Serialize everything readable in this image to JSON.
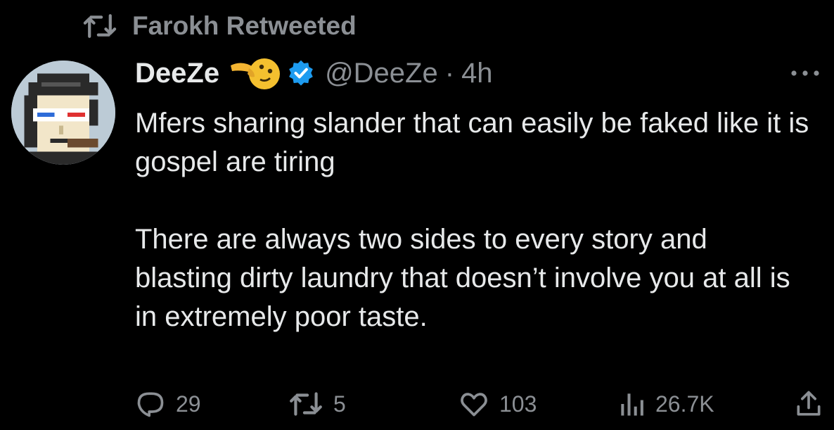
{
  "social_context": {
    "text": "Farokh Retweeted",
    "icon": "retweet-icon"
  },
  "author": {
    "display_name": "DeeZe",
    "handle": "@DeeZe",
    "separator": "·",
    "timestamp": "4h",
    "emoji": "pointing-face-emoji",
    "verified": true,
    "verified_color": "#1d9bf0"
  },
  "tweet": {
    "paragraphs": [
      "Mfers sharing slander that can easily be faked like it is gospel are tiring",
      "There are always two sides to every story and blasting dirty laundry that doesn’t involve you at all is in extremely poor taste."
    ]
  },
  "actions": {
    "reply_count": "29",
    "retweet_count": "5",
    "like_count": "103",
    "view_count": "26.7K"
  },
  "colors": {
    "background": "#000000",
    "text_primary": "#e7e9ea",
    "text_secondary": "#8b8f94"
  }
}
